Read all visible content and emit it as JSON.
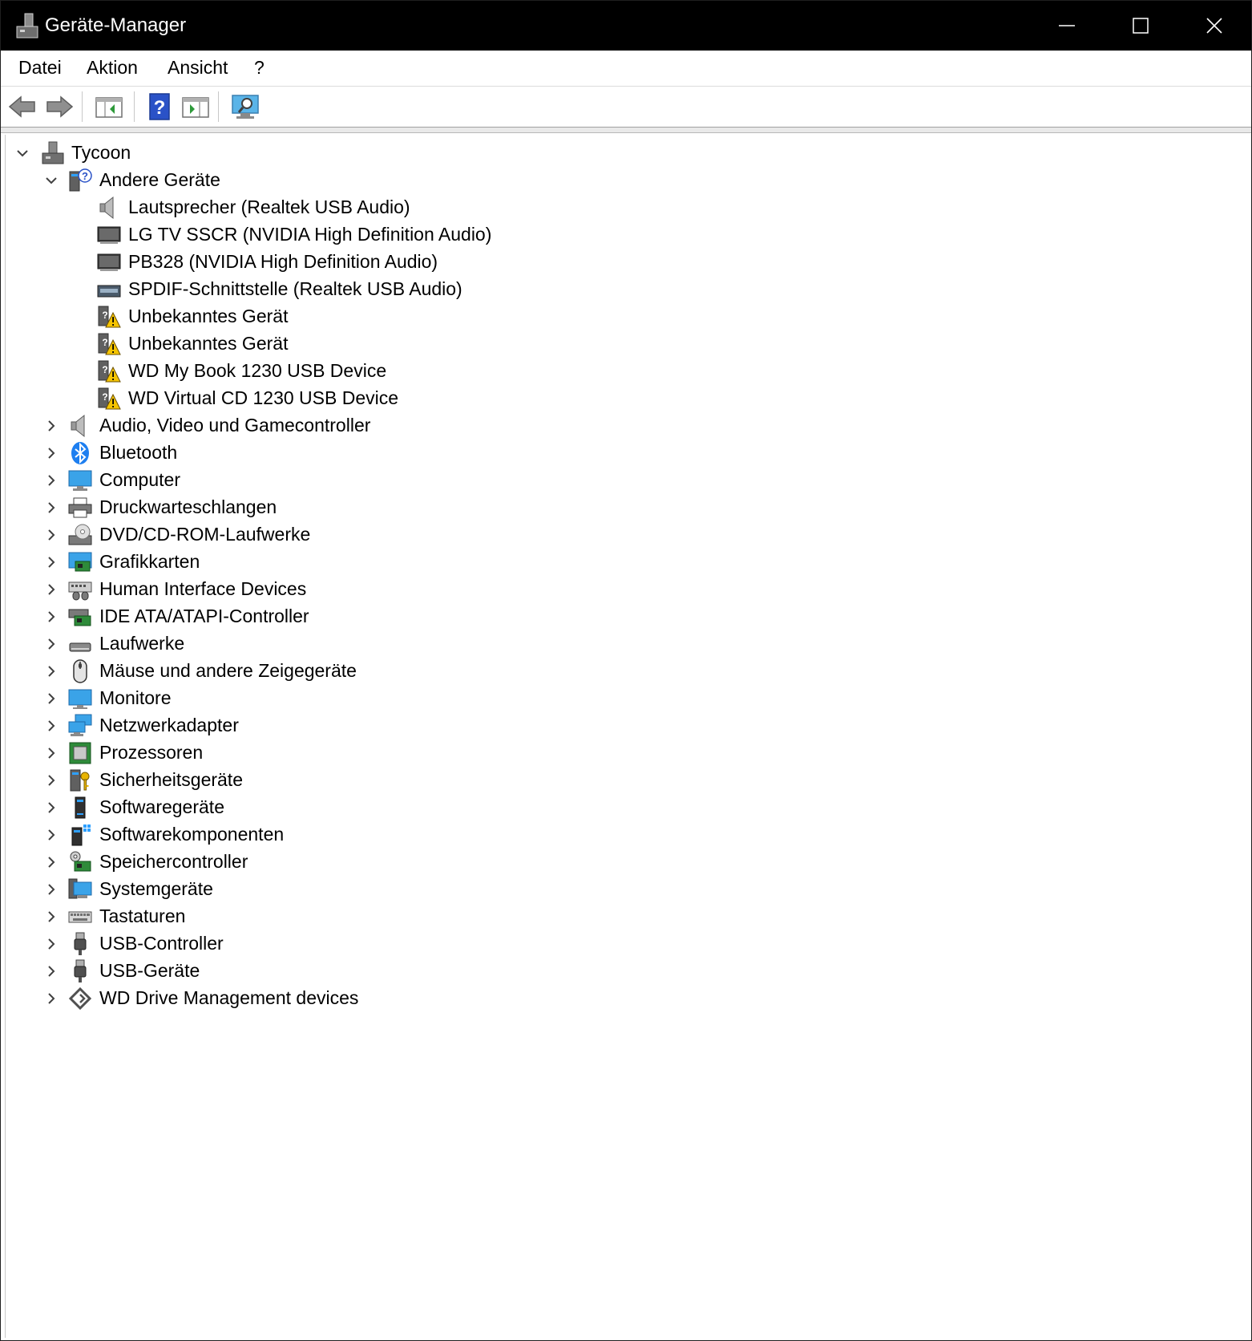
{
  "window": {
    "title": "Geräte-Manager",
    "icon": "device-manager-icon",
    "controls": {
      "minimize": "minimize-icon",
      "maximize": "maximize-icon",
      "close": "close-icon"
    }
  },
  "menu": {
    "items": [
      {
        "label": "Datei"
      },
      {
        "label": "Aktion"
      },
      {
        "label": "Ansicht"
      },
      {
        "label": "?"
      }
    ]
  },
  "toolbar": {
    "buttons": [
      {
        "icon": "back-arrow-icon"
      },
      {
        "icon": "forward-arrow-icon"
      },
      {
        "icon": "show-hide-console-tree-icon"
      },
      {
        "icon": "help-icon"
      },
      {
        "icon": "show-hide-action-pane-icon"
      },
      {
        "icon": "scan-hardware-icon"
      }
    ]
  },
  "tree": {
    "root": {
      "label": "Tycoon",
      "icon": "computer-tower-icon",
      "expanded": true
    },
    "expanded_category": {
      "label": "Andere Geräte",
      "icon": "other-devices-icon",
      "children": [
        {
          "label": "Lautsprecher (Realtek USB Audio)",
          "icon": "speaker-icon"
        },
        {
          "label": "LG TV SSCR (NVIDIA High Definition Audio)",
          "icon": "display-device-icon"
        },
        {
          "label": "PB328 (NVIDIA High Definition Audio)",
          "icon": "display-device-icon"
        },
        {
          "label": "SPDIF-Schnittstelle (Realtek USB Audio)",
          "icon": "spdif-icon"
        },
        {
          "label": "Unbekanntes Gerät",
          "icon": "unknown-device-warning-icon"
        },
        {
          "label": "Unbekanntes Gerät",
          "icon": "unknown-device-warning-icon"
        },
        {
          "label": "WD My Book 1230 USB Device",
          "icon": "unknown-device-warning-icon"
        },
        {
          "label": "WD Virtual CD 1230 USB Device",
          "icon": "unknown-device-warning-icon"
        }
      ]
    },
    "categories": [
      {
        "label": "Audio, Video und Gamecontroller",
        "icon": "speaker-icon"
      },
      {
        "label": "Bluetooth",
        "icon": "bluetooth-icon"
      },
      {
        "label": "Computer",
        "icon": "computer-monitor-icon"
      },
      {
        "label": "Druckwarteschlangen",
        "icon": "printer-icon"
      },
      {
        "label": "DVD/CD-ROM-Laufwerke",
        "icon": "dvd-drive-icon"
      },
      {
        "label": "Grafikkarten",
        "icon": "graphics-card-icon"
      },
      {
        "label": "Human Interface Devices",
        "icon": "hid-icon"
      },
      {
        "label": "IDE ATA/ATAPI-Controller",
        "icon": "ide-controller-icon"
      },
      {
        "label": "Laufwerke",
        "icon": "disk-drive-icon"
      },
      {
        "label": "Mäuse und andere Zeigegeräte",
        "icon": "mouse-icon"
      },
      {
        "label": "Monitore",
        "icon": "monitor-icon"
      },
      {
        "label": "Netzwerkadapter",
        "icon": "network-adapter-icon"
      },
      {
        "label": "Prozessoren",
        "icon": "processor-icon"
      },
      {
        "label": "Sicherheitsgeräte",
        "icon": "security-key-icon"
      },
      {
        "label": "Softwaregeräte",
        "icon": "software-device-icon"
      },
      {
        "label": "Softwarekomponenten",
        "icon": "software-component-icon"
      },
      {
        "label": "Speichercontroller",
        "icon": "storage-controller-icon"
      },
      {
        "label": "Systemgeräte",
        "icon": "system-devices-icon"
      },
      {
        "label": "Tastaturen",
        "icon": "keyboard-icon"
      },
      {
        "label": "USB-Controller",
        "icon": "usb-icon"
      },
      {
        "label": "USB-Geräte",
        "icon": "usb-icon"
      },
      {
        "label": "WD Drive Management devices",
        "icon": "wd-drive-management-icon"
      }
    ]
  }
}
